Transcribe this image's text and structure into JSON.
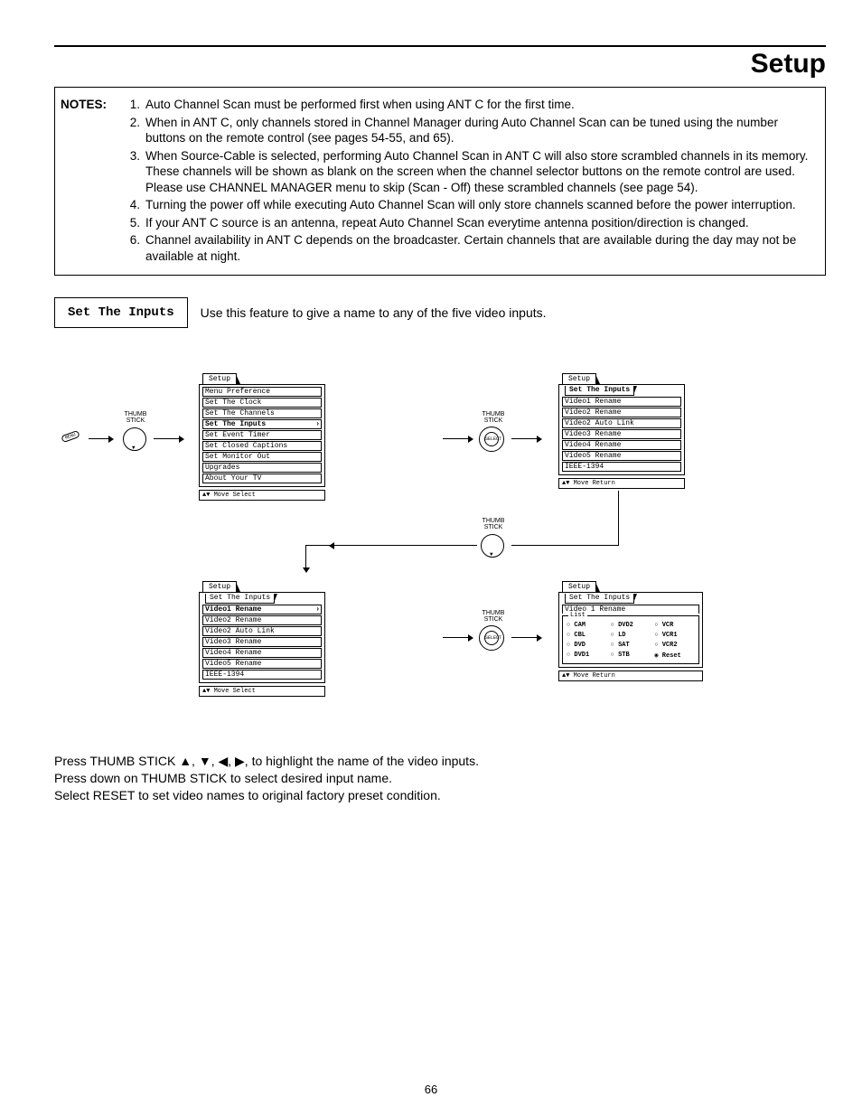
{
  "page_title": "Setup",
  "notes_label": "NOTES:",
  "notes": [
    "Auto Channel Scan must be performed first when using ANT C for the first time.",
    "When in ANT C, only channels stored in Channel Manager during Auto Channel Scan can be tuned using the number buttons on the remote control (see pages 54-55, and 65).",
    "When Source-Cable is selected, performing Auto Channel Scan in ANT C will also store scrambled channels in its memory. These channels will be shown as blank on the screen when the channel selector buttons on the remote control are used.   Please use CHANNEL MANAGER menu to skip (Scan - Off) these scrambled channels (see page 54).",
    "Turning the power off while executing Auto Channel Scan will only store channels scanned before the power interruption.",
    "If your ANT C source is an antenna, repeat Auto Channel Scan everytime antenna position/direction is changed.",
    "Channel availability in ANT C depends on the broadcaster.  Certain channels that are available during the day may not be available at night."
  ],
  "set_inputs_label": "Set The Inputs",
  "set_inputs_desc": "Use this feature to give a name to any of the five video inputs.",
  "menus": {
    "setup_tab": "Setup",
    "main": [
      "Menu Preference",
      "Set The Clock",
      "Set The Channels",
      "Set The Inputs",
      "Set Event Timer",
      "Set Closed Captions",
      "Set Monitor Out",
      "Upgrades",
      "About Your TV"
    ],
    "main_hl": 3,
    "inputs": [
      "Video1 Rename",
      "Video2 Rename",
      "Video2 Auto Link",
      "Video3 Rename",
      "Video4 Rename",
      "Video5 Rename",
      "IEEE-1394"
    ],
    "inputs_hl_bottom": 0,
    "rename_sub_tab": "Set The Inputs",
    "video1_tab": "Video 1 Rename",
    "list": [
      "CAM",
      "DVD2",
      "VCR",
      "CBL",
      "LD",
      "VCR1",
      "DVD",
      "SAT",
      "VCR2",
      "DVD1",
      "STB",
      "Reset"
    ],
    "list_selected": 11,
    "footer_sel": "   Move      Select",
    "footer_ret": "   Move      Return"
  },
  "labels": {
    "thumb": "THUMB\nSTICK",
    "select": "SELECT",
    "menu": "MENU"
  },
  "description_lines": [
    "Press THUMB STICK ▲, ▼, ◀, ▶, to highlight the name of the video inputs.",
    "Press down on THUMB STICK to select desired input name.",
    "",
    "Select RESET to set video names to original factory preset condition."
  ],
  "page_number": "66"
}
